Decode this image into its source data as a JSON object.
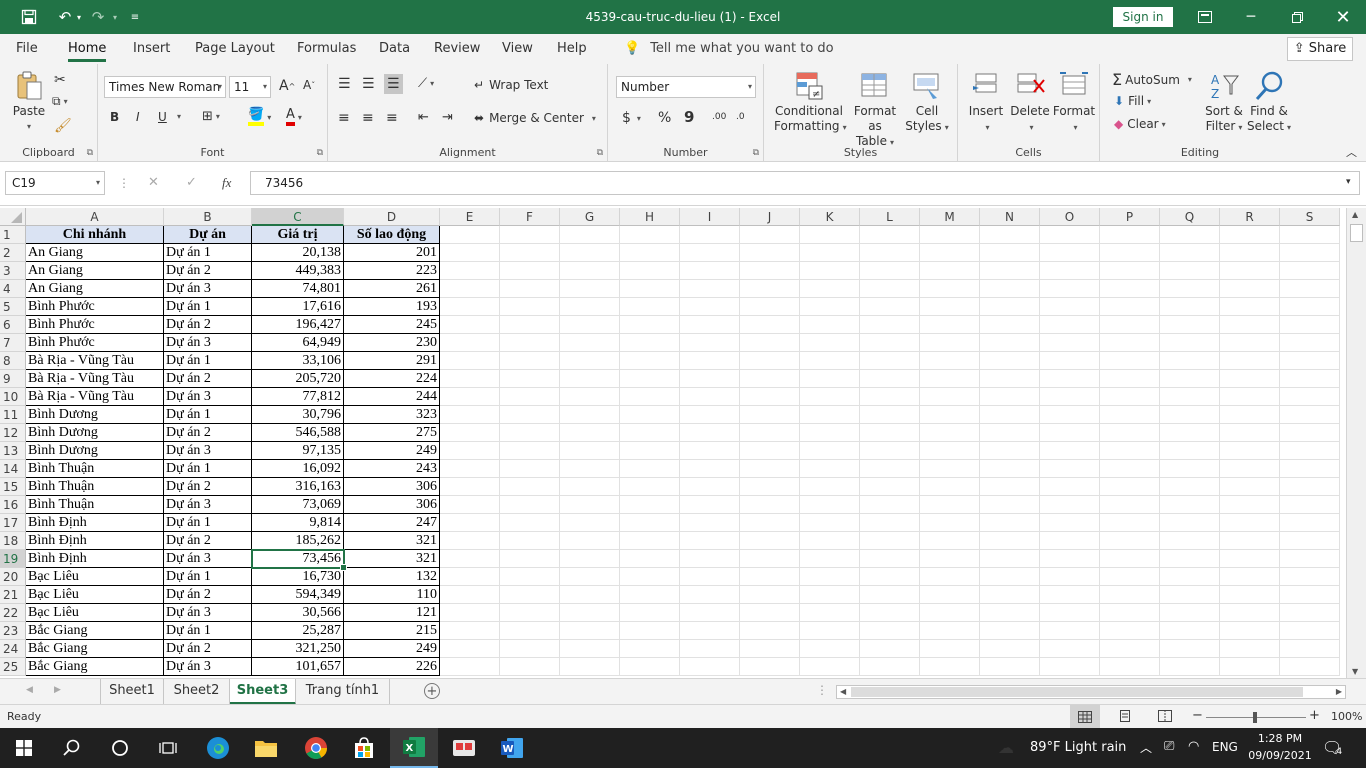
{
  "window": {
    "title": "4539-cau-truc-du-lieu (1)  -  Excel",
    "sign_in": "Sign in"
  },
  "ribbon_tabs": [
    "File",
    "Home",
    "Insert",
    "Page Layout",
    "Formulas",
    "Data",
    "Review",
    "View",
    "Help"
  ],
  "active_tab": "Home",
  "tell_me": "Tell me what you want to do",
  "share": "Share",
  "ribbon": {
    "clipboard": {
      "label": "Clipboard",
      "paste": "Paste"
    },
    "font": {
      "label": "Font",
      "name": "Times New Roman",
      "size": "11",
      "bold": "B",
      "italic": "I",
      "underline": "U"
    },
    "alignment": {
      "label": "Alignment",
      "wrap_text": "Wrap Text",
      "merge_center": "Merge & Center"
    },
    "number": {
      "label": "Number",
      "format": "Number",
      "currency": "$",
      "percent": "%",
      "comma": "9",
      "inc_decimal": ".00",
      "dec_decimal": ".0"
    },
    "styles": {
      "label": "Styles",
      "conditional_1": "Conditional",
      "conditional_2": "Formatting",
      "format_table_1": "Format as",
      "format_table_2": "Table",
      "cell_styles_1": "Cell",
      "cell_styles_2": "Styles"
    },
    "cells": {
      "label": "Cells",
      "insert": "Insert",
      "delete": "Delete",
      "format": "Format"
    },
    "editing": {
      "label": "Editing",
      "autosum": "AutoSum",
      "fill": "Fill",
      "clear": "Clear",
      "sort_1": "Sort &",
      "sort_2": "Filter",
      "find_1": "Find &",
      "find_2": "Select"
    }
  },
  "formula_bar": {
    "name_box": "C19",
    "value": "73456",
    "fx": "fx"
  },
  "columns": [
    "A",
    "B",
    "C",
    "D",
    "E",
    "F",
    "G",
    "H",
    "I",
    "J",
    "K",
    "L",
    "M",
    "N",
    "O",
    "P",
    "Q",
    "R",
    "S"
  ],
  "selected_column": "C",
  "selected_row": 19,
  "table_headers": [
    "Chi nhánh",
    "Dự án",
    "Giá trị",
    "Số lao động"
  ],
  "rows": [
    [
      "An Giang",
      "Dự án 1",
      "20,138",
      "201"
    ],
    [
      "An Giang",
      "Dự án 2",
      "449,383",
      "223"
    ],
    [
      "An Giang",
      "Dự án 3",
      "74,801",
      "261"
    ],
    [
      "Bình Phước",
      "Dự án 1",
      "17,616",
      "193"
    ],
    [
      "Bình Phước",
      "Dự án 2",
      "196,427",
      "245"
    ],
    [
      "Bình Phước",
      "Dự án 3",
      "64,949",
      "230"
    ],
    [
      "Bà Rịa - Vũng Tàu",
      "Dự án 1",
      "33,106",
      "291"
    ],
    [
      "Bà Rịa - Vũng Tàu",
      "Dự án 2",
      "205,720",
      "224"
    ],
    [
      "Bà Rịa - Vũng Tàu",
      "Dự án 3",
      "77,812",
      "244"
    ],
    [
      "Bình Dương",
      "Dự án 1",
      "30,796",
      "323"
    ],
    [
      "Bình Dương",
      "Dự án 2",
      "546,588",
      "275"
    ],
    [
      "Bình Dương",
      "Dự án 3",
      "97,135",
      "249"
    ],
    [
      "Bình Thuận",
      "Dự án 1",
      "16,092",
      "243"
    ],
    [
      "Bình Thuận",
      "Dự án 2",
      "316,163",
      "306"
    ],
    [
      "Bình Thuận",
      "Dự án 3",
      "73,069",
      "306"
    ],
    [
      "Bình Định",
      "Dự án 1",
      "9,814",
      "247"
    ],
    [
      "Bình Định",
      "Dự án 2",
      "185,262",
      "321"
    ],
    [
      "Bình Định",
      "Dự án 3",
      "73,456",
      "321"
    ],
    [
      "Bạc Liêu",
      "Dự án 1",
      "16,730",
      "132"
    ],
    [
      "Bạc Liêu",
      "Dự án 2",
      "594,349",
      "110"
    ],
    [
      "Bạc Liêu",
      "Dự án 3",
      "30,566",
      "121"
    ],
    [
      "Bắc Giang",
      "Dự án 1",
      "25,287",
      "215"
    ],
    [
      "Bắc Giang",
      "Dự án 2",
      "321,250",
      "249"
    ],
    [
      "Bắc Giang",
      "Dự án 3",
      "101,657",
      "226"
    ]
  ],
  "sheets": [
    "Sheet1",
    "Sheet2",
    "Sheet3",
    "Trang tính1"
  ],
  "active_sheet": "Sheet3",
  "status": {
    "ready": "Ready",
    "zoom": "100%"
  },
  "taskbar": {
    "weather": "89°F  Light rain",
    "lang": "ENG",
    "time": "1:28 PM",
    "date": "09/09/2021",
    "notifications": "4"
  },
  "colors": {
    "excel_green": "#217346",
    "header_fill": "#dae3f3"
  }
}
